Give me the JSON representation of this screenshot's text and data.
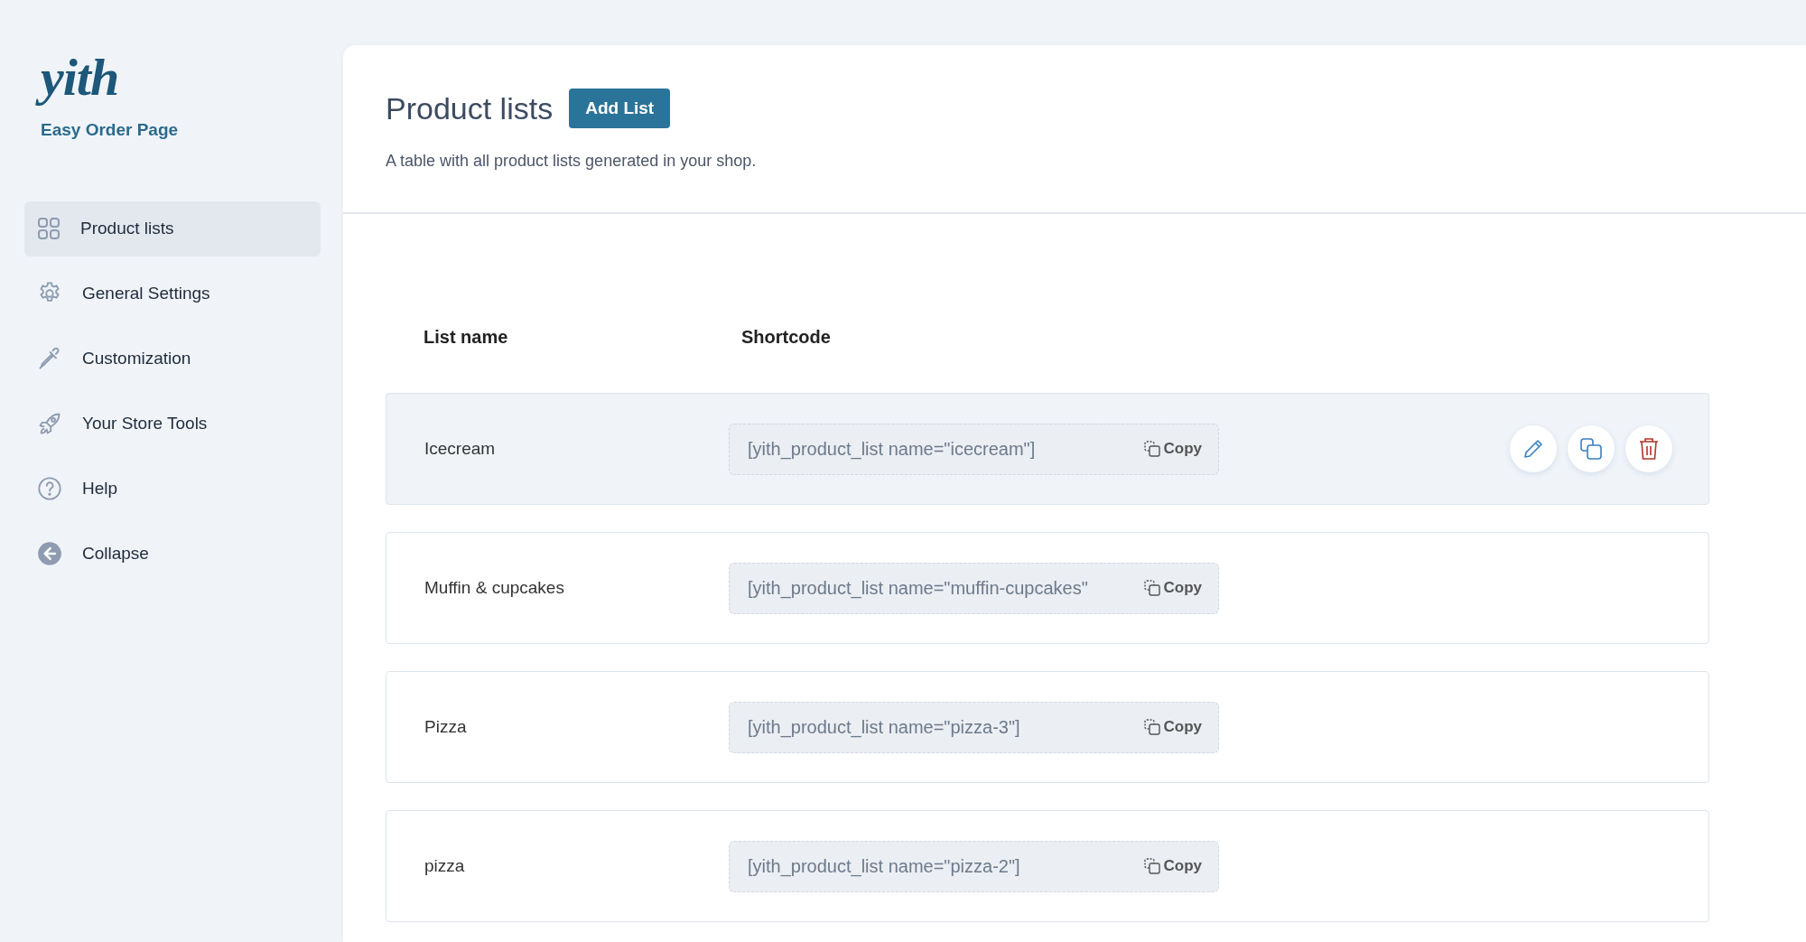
{
  "logo": {
    "text": "yith",
    "subtitle": "Easy Order Page"
  },
  "sidebar": {
    "items": [
      {
        "label": "Product lists",
        "selected": true
      },
      {
        "label": "General Settings",
        "selected": false
      },
      {
        "label": "Customization",
        "selected": false
      },
      {
        "label": "Your Store Tools",
        "selected": false
      },
      {
        "label": "Help",
        "selected": false
      },
      {
        "label": "Collapse",
        "selected": false
      }
    ]
  },
  "header": {
    "title": "Product lists",
    "add_button": "Add List",
    "description": "A table with all product lists generated in your shop."
  },
  "table": {
    "columns": [
      "List name",
      "Shortcode"
    ],
    "rows": [
      {
        "name": "Icecream",
        "shortcode": "[yith_product_list name=\"icecream\"]",
        "copy": "Copy",
        "hovered": true
      },
      {
        "name": "Muffin & cupcakes",
        "shortcode": "[yith_product_list name=\"muffin-cupcakes\"",
        "copy": "Copy",
        "hovered": false
      },
      {
        "name": "Pizza",
        "shortcode": "[yith_product_list name=\"pizza-3\"]",
        "copy": "Copy",
        "hovered": false
      },
      {
        "name": "pizza",
        "shortcode": "[yith_product_list name=\"pizza-2\"]",
        "copy": "Copy",
        "hovered": false
      }
    ]
  }
}
